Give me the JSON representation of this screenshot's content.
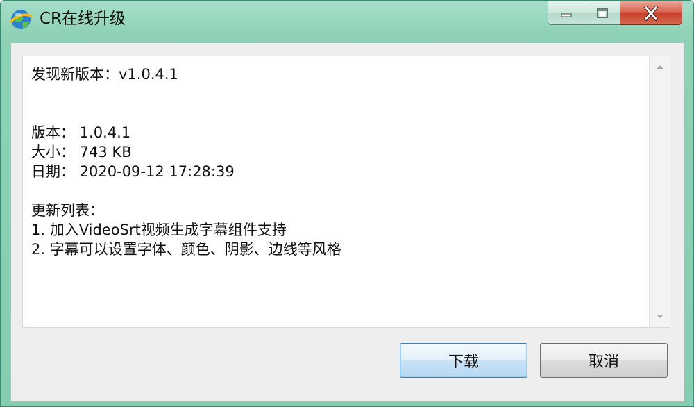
{
  "window": {
    "title": "CR在线升级"
  },
  "caption_buttons": {
    "minimize_icon": "minimize-icon",
    "maximize_icon": "maximize-icon",
    "close_icon": "close-icon"
  },
  "content": {
    "lines": [
      "发现新版本：v1.0.4.1",
      "",
      "",
      "版本： 1.0.4.1",
      "大小： 743 KB",
      "日期： 2020-09-12 17:28:39",
      "",
      "更新列表：",
      "1. 加入VideoSrt视频生成字幕组件支持",
      "2. 字幕可以设置字体、颜色、阴影、边线等风格"
    ]
  },
  "buttons": {
    "download_label": "下载",
    "cancel_label": "取消"
  },
  "colors": {
    "frame": "#84cdb0",
    "close_button": "#c9402a",
    "default_button_border": "#3c7fb1"
  }
}
